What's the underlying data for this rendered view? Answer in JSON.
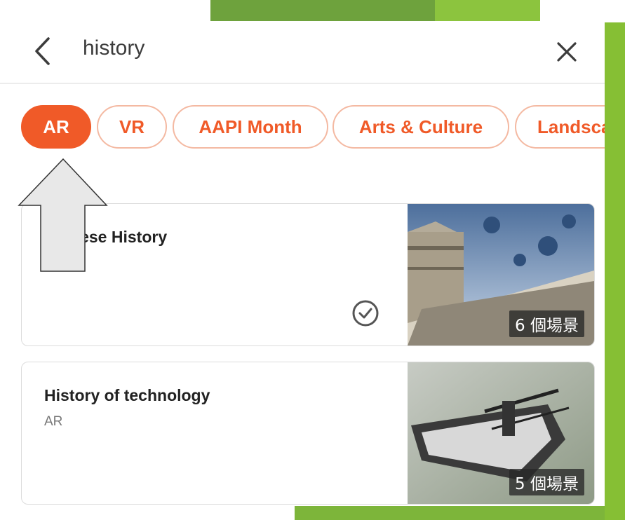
{
  "search": {
    "query": "history"
  },
  "chips": [
    {
      "label": "AR",
      "active": true
    },
    {
      "label": "VR",
      "active": false
    },
    {
      "label": "AAPI Month",
      "active": false
    },
    {
      "label": "Arts & Culture",
      "active": false
    },
    {
      "label": "Landscapes",
      "active": false
    }
  ],
  "results": [
    {
      "title": "Chinese History",
      "subtitle": "",
      "scenes": "6 個場景",
      "downloaded": true,
      "thumb_icon": "great-wall-photo"
    },
    {
      "title": "History of technology",
      "subtitle": "AR",
      "scenes": "5 個場景",
      "downloaded": false,
      "thumb_icon": "pantograph-machine-photo"
    }
  ],
  "colors": {
    "accent": "#f05a28",
    "chip_border": "#f4b9a2",
    "deco_green": "#86bf34"
  }
}
